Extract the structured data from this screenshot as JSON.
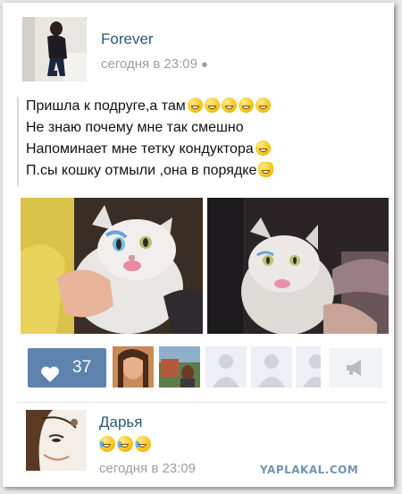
{
  "post": {
    "author": "Forever",
    "time": "сегодня в 23:09",
    "time_icon": "apple-icon",
    "lines": [
      "Пришла к подруге,а там",
      "Не знаю почему мне так смешно",
      "Напоминает мне тетку кондуктора",
      "П.сы кошку отмыли ,она в порядке"
    ],
    "emoji": {
      "line1": "grinning-face-emoji x5",
      "line3": "grinning-face-emoji",
      "line4": "cat-face-emoji"
    }
  },
  "actions": {
    "like_count": "37",
    "like_icon": "heart-icon",
    "share_icon": "megaphone-icon"
  },
  "comment": {
    "author": "Дарья",
    "emoji": "crying-laughing-face-emoji x3",
    "time": "сегодня в 23:09"
  },
  "watermark": "YAPLAKAL.COM",
  "colors": {
    "link": "#2b587a",
    "like_button": "#5d82ad",
    "muted_text": "#9a9ea3",
    "watermark": "#6f94b4"
  }
}
